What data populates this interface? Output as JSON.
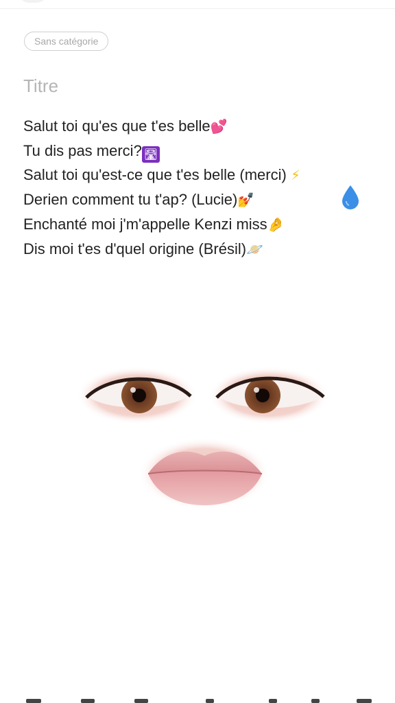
{
  "category": {
    "label": "Sans catégorie"
  },
  "title": {
    "placeholder": "Titre"
  },
  "note": {
    "lines": [
      {
        "text": "Salut toi qu'es que t'es belle",
        "emoji": "💕"
      },
      {
        "text": "Tu dis pas merci?",
        "emoji": "🛣"
      },
      {
        "text": "Salut toi qu'est-ce que t'es belle (merci)",
        "emoji": "⚡"
      },
      {
        "text": "Derien comment tu t'ap? (Lucie)",
        "emoji": "💅"
      },
      {
        "text": "Enchanté moi j'm'appelle Kenzi miss",
        "emoji": "🤌"
      },
      {
        "text": "Dis moi t'es d'quel origine (Brésil)",
        "emoji": "🪐"
      }
    ]
  },
  "stickers": {
    "drop": "water-drop-icon",
    "face": [
      "left-eye",
      "right-eye",
      "lips"
    ]
  },
  "colors": {
    "text": "#222222",
    "placeholder": "#b5b5b5",
    "chip_border": "#cfcfcf",
    "drop": "#3b8fe6"
  }
}
